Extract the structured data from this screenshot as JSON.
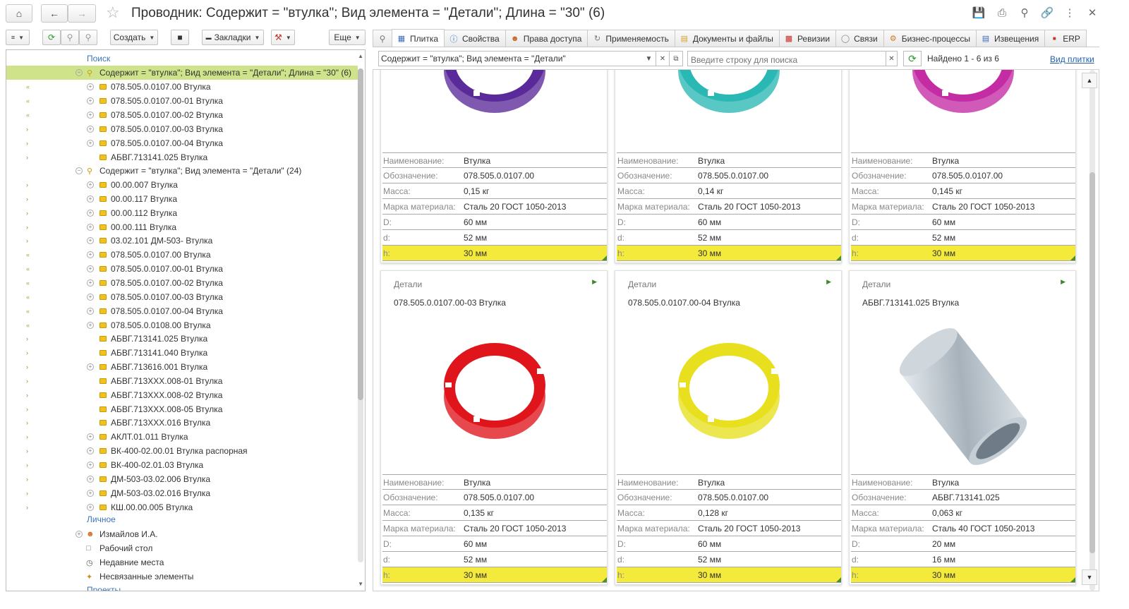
{
  "window": {
    "title": "Проводник: Содержит = \"втулка\"; Вид элемента = \"Детали\"; Длина = \"30\" (6)"
  },
  "left_toolbar": {
    "create_label": "Создать",
    "bookmarks_label": "Закладки",
    "more_label": "Еще"
  },
  "tree": {
    "search_section": "Поиск",
    "personal_section": "Личное",
    "projects_section": "Проекты",
    "query1": "Содержит = \"втулка\"; Вид элемента = \"Детали\"; Длина = \"30\" (6)",
    "query1_items": [
      "078.505.0.0107.00 Втулка",
      "078.505.0.0107.00-01 Втулка",
      "078.505.0.0107.00-02 Втулка",
      "078.505.0.0107.00-03 Втулка",
      "078.505.0.0107.00-04 Втулка",
      "АБВГ.713141.025 Втулка"
    ],
    "query2": "Содержит = \"втулка\"; Вид элемента = \"Детали\" (24)",
    "query2_items": [
      "00.00.007 Втулка",
      "00.00.117 Втулка",
      "00.00.112 Втулка",
      "00.00.111 Втулка",
      "03.02.101 ДМ-503- Втулка",
      "078.505.0.0107.00 Втулка",
      "078.505.0.0107.00-01 Втулка",
      "078.505.0.0107.00-02 Втулка",
      "078.505.0.0107.00-03 Втулка",
      "078.505.0.0107.00-04 Втулка",
      "078.505.0.0108.00 Втулка",
      "АБВГ.713141.025 Втулка",
      "АБВГ.713141.040 Втулка",
      "АБВГ.713616.001 Втулка",
      "АБВГ.713ХХХ.008-01 Втулка",
      "АБВГ.713ХХХ.008-02 Втулка",
      "АБВГ.713ХХХ.008-05 Втулка",
      "АБВГ.713ХХХ.016 Втулка",
      "АКЛТ.01.011 Втулка",
      "ВК-400-02.00.01 Втулка распорная",
      "ВК-400-02.01.03 Втулка",
      "ДМ-503-03.02.006 Втулка",
      "ДМ-503-03.02.016 Втулка",
      "КШ.00.00.005 Втулка"
    ],
    "personal_items": [
      "Измайлов И.А.",
      "Рабочий стол",
      "Недавние места",
      "Несвязанные элементы"
    ]
  },
  "tabs": [
    {
      "label": "Плитка",
      "icon": "tile-icon"
    },
    {
      "label": "Свойства",
      "icon": "info-icon"
    },
    {
      "label": "Права доступа",
      "icon": "users-icon"
    },
    {
      "label": "Применяемость",
      "icon": "link-icon"
    },
    {
      "label": "Документы и файлы",
      "icon": "document-icon"
    },
    {
      "label": "Ревизии",
      "icon": "revisions-icon"
    },
    {
      "label": "Связи",
      "icon": "clip-icon"
    },
    {
      "label": "Бизнес-процессы",
      "icon": "process-icon"
    },
    {
      "label": "Извещения",
      "icon": "notice-icon"
    },
    {
      "label": "ERP",
      "icon": "erp-icon"
    }
  ],
  "filter": {
    "value": "Содержит = \"втулка\"; Вид элемента = \"Детали\"",
    "search_placeholder": "Введите строку для поиска",
    "found_text": "Найдено 1 - 6 из 6",
    "view_link": "Вид плитки"
  },
  "prop_labels": [
    "Наименование:",
    "Обозначение:",
    "Масса:",
    "Марка материала:",
    "D:",
    "d:",
    "h:"
  ],
  "cards": [
    {
      "kind": "",
      "title": "",
      "color": "#5b2a9a",
      "values": [
        "Втулка",
        "078.505.0.0107.00",
        "0,15 кг",
        "Сталь 20 ГОСТ 1050-2013",
        "60 мм",
        "52 мм",
        "30 мм"
      ]
    },
    {
      "kind": "",
      "title": "",
      "color": "#2ab8b4",
      "values": [
        "Втулка",
        "078.505.0.0107.00",
        "0,14 кг",
        "Сталь 20 ГОСТ 1050-2013",
        "60 мм",
        "52 мм",
        "30 мм"
      ]
    },
    {
      "kind": "",
      "title": "",
      "color": "#c42ca4",
      "values": [
        "Втулка",
        "078.505.0.0107.00",
        "0,145 кг",
        "Сталь 20 ГОСТ 1050-2013",
        "60 мм",
        "52 мм",
        "30 мм"
      ]
    },
    {
      "kind": "Детали",
      "title": "078.505.0.0107.00-03 Втулка",
      "color": "#e0151c",
      "values": [
        "Втулка",
        "078.505.0.0107.00",
        "0,135 кг",
        "Сталь 20 ГОСТ 1050-2013",
        "60 мм",
        "52 мм",
        "30 мм"
      ]
    },
    {
      "kind": "Детали",
      "title": "078.505.0.0107.00-04 Втулка",
      "color": "#e8e01e",
      "values": [
        "Втулка",
        "078.505.0.0107.00",
        "0,128 кг",
        "Сталь 20 ГОСТ 1050-2013",
        "60 мм",
        "52 мм",
        "30 мм"
      ]
    },
    {
      "kind": "Детали",
      "title": "АБВГ.713141.025 Втулка",
      "color": "#b9c3cc",
      "values": [
        "Втулка",
        "АБВГ.713141.025",
        "0,063 кг",
        "Сталь 40 ГОСТ 1050-2013",
        "20 мм",
        "16 мм",
        "30 мм"
      ]
    }
  ]
}
